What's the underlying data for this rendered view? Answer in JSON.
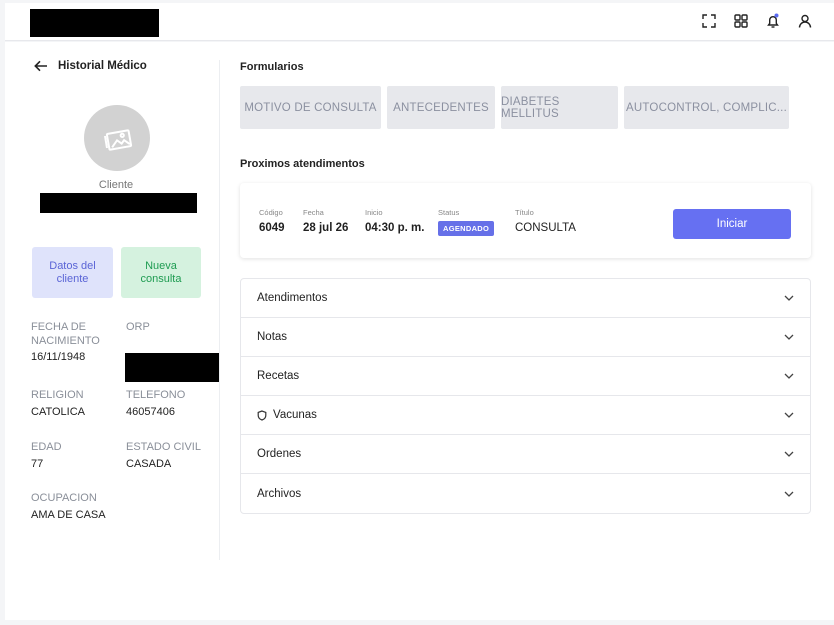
{
  "topbar": {
    "icons": [
      "fullscreen-icon",
      "grid-icon",
      "bell-icon",
      "user-icon"
    ],
    "notification_dot_color": "#5b6bf0"
  },
  "sidebar": {
    "back_label": "Historial Médico",
    "client_label": "Cliente",
    "btn_datos": "Datos del cliente",
    "btn_nueva": "Nueva consulta",
    "fields": {
      "fecha_nac": {
        "label": "FECHA DE NACIMIENTO",
        "value": "16/11/1948"
      },
      "orp": {
        "label": "ORP"
      },
      "religion": {
        "label": "RELIGION",
        "value": "CATOLICA"
      },
      "telefono": {
        "label": "TELEFONO",
        "value": "46057406"
      },
      "edad": {
        "label": "EDAD",
        "value": "77"
      },
      "estado_civil": {
        "label": "ESTADO CIVIL",
        "value": "CASADA"
      },
      "ocupacion": {
        "label": "OCUPACION",
        "value": "AMA DE CASA"
      }
    }
  },
  "main": {
    "formularios_title": "Formularios",
    "form_tabs": [
      "MOTIVO DE CONSULTA",
      "ANTECEDENTES",
      "DIABETES MELLITUS",
      "AUTOCONTROL, COMPLIC..."
    ],
    "proximos_title": "Proximos atendimentos",
    "appointment": {
      "codigo_label": "Código",
      "codigo": "6049",
      "fecha_label": "Fecha",
      "fecha": "28 jul 26",
      "inicio_label": "Inicio",
      "inicio": "04:30 p. m.",
      "status_label": "Status",
      "status": "AGENDADO",
      "titulo_label": "Título",
      "titulo": "CONSULTA",
      "button": "Iniciar"
    },
    "accordion": [
      "Atendimentos",
      "Notas",
      "Recetas",
      "Vacunas",
      "Ordenes",
      "Archivos"
    ]
  },
  "colors": {
    "accent": "#6670f2",
    "badge": "#6670e8",
    "green": "#1f9c52"
  }
}
